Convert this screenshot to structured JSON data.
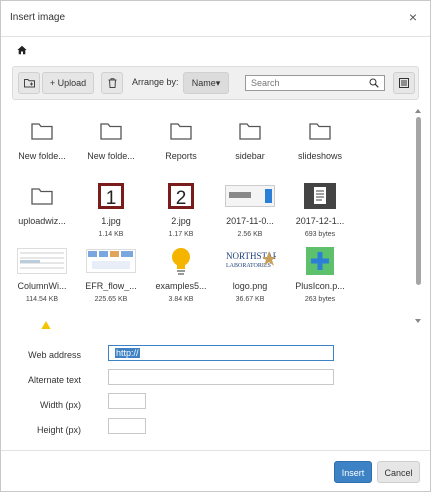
{
  "dialog": {
    "title": "Insert image",
    "close_glyph": "×"
  },
  "toolbar": {
    "upload_label": "+ Upload",
    "arrange_label": "Arrange by:",
    "arrange_value": "Name▾",
    "search_placeholder": "Search"
  },
  "files": [
    {
      "name": "New folde...",
      "size": "",
      "kind": "folder"
    },
    {
      "name": "New folde...",
      "size": "",
      "kind": "folder"
    },
    {
      "name": "Reports",
      "size": "",
      "kind": "folder"
    },
    {
      "name": "sidebar",
      "size": "",
      "kind": "folder"
    },
    {
      "name": "slideshows",
      "size": "",
      "kind": "folder"
    },
    {
      "name": "uploadwiz...",
      "size": "",
      "kind": "folder"
    },
    {
      "name": "1.jpg",
      "size": "1.14 KB",
      "kind": "number-1"
    },
    {
      "name": "2.jpg",
      "size": "1.17 KB",
      "kind": "number-2"
    },
    {
      "name": "2017-11-0...",
      "size": "2.56 KB",
      "kind": "screenshot"
    },
    {
      "name": "2017-12-1...",
      "size": "693 bytes",
      "kind": "document"
    },
    {
      "name": "ColumnWi...",
      "size": "114.54 KB",
      "kind": "table"
    },
    {
      "name": "EFR_flow_...",
      "size": "225.65 KB",
      "kind": "flow"
    },
    {
      "name": "examples5...",
      "size": "3.84 KB",
      "kind": "bulb"
    },
    {
      "name": "logo.png",
      "size": "36.67 KB",
      "kind": "logo"
    },
    {
      "name": "PlusIcon.p...",
      "size": "263 bytes",
      "kind": "plus"
    }
  ],
  "form": {
    "web_address_label": "Web address",
    "web_address_value": "http://",
    "alt_text_label": "Alternate text",
    "alt_text_value": "",
    "width_label": "Width (px)",
    "width_value": "",
    "height_label": "Height (px)",
    "height_value": ""
  },
  "footer": {
    "insert_label": "Insert",
    "cancel_label": "Cancel"
  },
  "colors": {
    "primary": "#3d82c4",
    "thumbnail_maroon": "#7b1c1c",
    "plus_green": "#5cc06c",
    "plus_blue": "#2c7fd6",
    "bulb_yellow": "#f5b400"
  }
}
